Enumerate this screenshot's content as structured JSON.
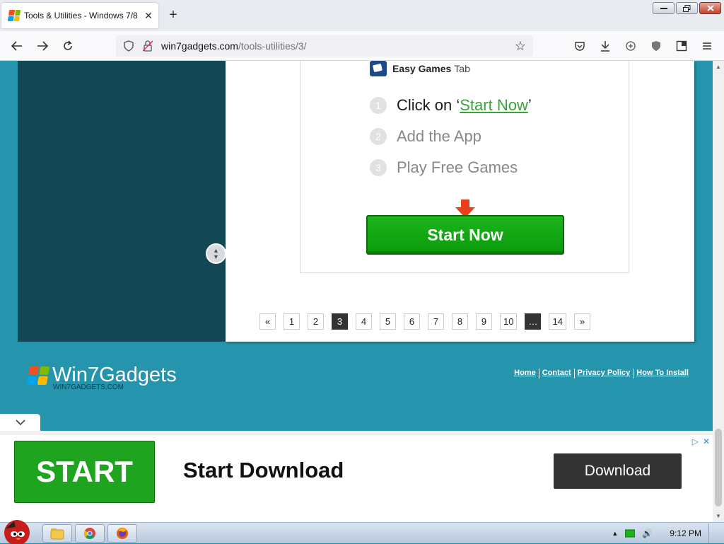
{
  "browser": {
    "tab_title": "Tools & Utilities - Windows 7/8",
    "tab_close": "✕",
    "new_tab": "+",
    "url_domain": "win7gadgets.com",
    "url_path": "/tools-utilities/3/"
  },
  "ad_box": {
    "brand_bold": "Easy Games",
    "brand_rest": "Tab",
    "steps": [
      {
        "num": "1",
        "before": "Click on ‘",
        "link": "Start Now",
        "after": "’"
      },
      {
        "num": "2",
        "text": "Add the App"
      },
      {
        "num": "3",
        "text": "Play Free Games"
      }
    ],
    "button": "Start Now"
  },
  "pagination": {
    "prev": "«",
    "pages": [
      "1",
      "2",
      "3",
      "4",
      "5",
      "6",
      "7",
      "8",
      "9",
      "10"
    ],
    "active": "3",
    "dots": "…",
    "last": "14",
    "next": "»"
  },
  "footer": {
    "brand": "Win7Gadgets",
    "brand_sub": "WIN7GADGETS.COM",
    "links": [
      "Home",
      "Contact",
      "Privacy Policy",
      "How To Install"
    ]
  },
  "bottom_ad": {
    "start": "START",
    "headline": "Start Download",
    "download": "Download"
  },
  "taskbar": {
    "time": "9:12 PM"
  },
  "colors": {
    "page_bg": "#2595ad",
    "left_panel": "#124754",
    "green_button": "#1fa41f",
    "link_green": "#3aa43a"
  }
}
